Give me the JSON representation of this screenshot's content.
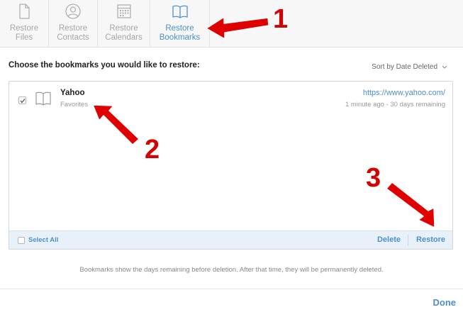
{
  "toolbar": {
    "tabs": [
      {
        "line1": "Restore",
        "line2": "Files",
        "icon": "file-icon"
      },
      {
        "line1": "Restore",
        "line2": "Contacts",
        "icon": "contact-icon"
      },
      {
        "line1": "Restore",
        "line2": "Calendars",
        "icon": "calendar-icon"
      },
      {
        "line1": "Restore",
        "line2": "Bookmarks",
        "icon": "book-icon",
        "active": true
      }
    ]
  },
  "main": {
    "heading": "Choose the bookmarks you would like to restore:",
    "sort_label": "Sort by Date Deleted"
  },
  "bookmarks": [
    {
      "title": "Yahoo",
      "folder": "Favorites",
      "url": "https://www.yahoo.com/",
      "time": "1 minute ago - 30 days remaining",
      "checked": true
    }
  ],
  "footer": {
    "select_all": "Select All",
    "delete": "Delete",
    "restore": "Restore"
  },
  "note": "Bookmarks show the days remaining before deletion. After that time, they will be permanently deleted.",
  "done": "Done",
  "annotations": [
    "1",
    "2",
    "3"
  ],
  "colors": {
    "accent": "#4a90d0",
    "annotation": "#d50000"
  }
}
